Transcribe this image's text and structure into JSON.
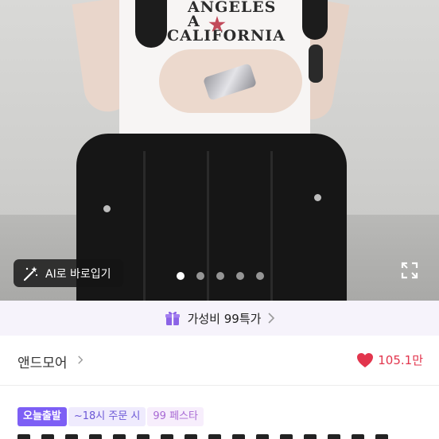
{
  "hero": {
    "shirt_print_line1": "ANGELES A",
    "shirt_print_line2": "CALIFORNIA",
    "ai_button_label": "AI로 바로입기",
    "carousel": {
      "total": 5,
      "active_index": 0
    }
  },
  "promo": {
    "label": "가성비 99특가"
  },
  "brand": {
    "name": "앤드모어",
    "likes": "105.1만"
  },
  "badges": {
    "today_ship": "오늘출발",
    "order_cutoff": "~18시 주문 시",
    "festa": "99 페스타"
  },
  "colors": {
    "accent": "#7d5ff5",
    "heart": "#e2354d",
    "promo_bg": "#f6f3fb"
  },
  "icons": [
    "magic-wand-icon",
    "expand-icon",
    "gift-icon",
    "chevron-right-icon",
    "heart-icon"
  ]
}
